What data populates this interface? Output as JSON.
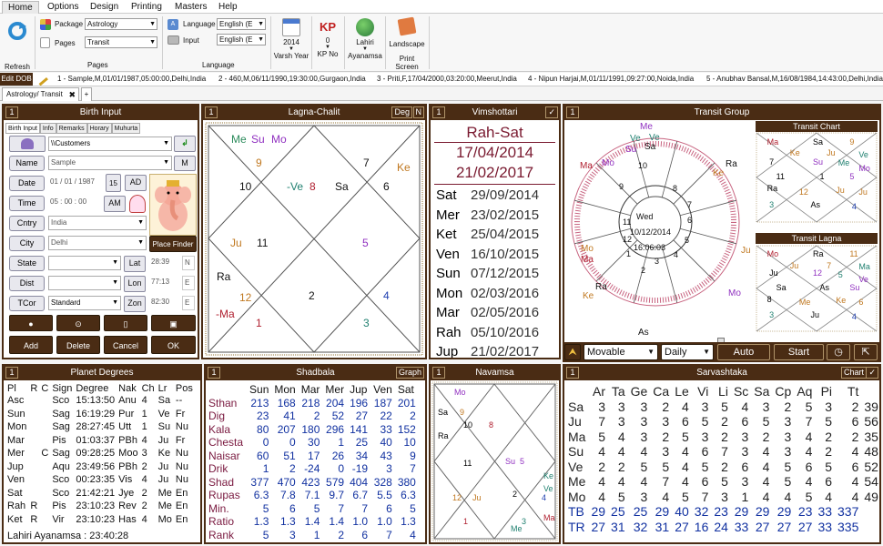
{
  "menu": [
    "Home",
    "Options",
    "Design",
    "Printing",
    "Masters",
    "Help"
  ],
  "ribbon": {
    "refresh": "Refresh",
    "package_label": "Package",
    "package_value": "Astrology",
    "pages_label": "Pages",
    "pages_value": "Transit",
    "pages_group": "Pages",
    "language_label": "Language",
    "language_value": "English (E",
    "input_label": "Input",
    "input_value": "English (E",
    "language_group": "Language",
    "varsh_value": "2014",
    "varsh_label": "Varsh Year",
    "kp_value": "0",
    "kp_label": "KP No",
    "kp_icon": "KP",
    "ayan_value": "Lahiri",
    "ayan_label": "Ayanamsa",
    "print_value": "Landscape",
    "print_label": "Print Screen"
  },
  "recents": {
    "edit": "Edit DOB",
    "items": [
      "1 - Sample,M,01/01/1987,05:00:00,Delhi,India",
      "2 - 460,M,06/11/1990,19:30:00,Gurgaon,India",
      "3 - Priti,F,17/04/2000,03:20:00,Meerut,India",
      "4 - Nipun Harjai,M,01/11/1991,09:27:00,Noida,India",
      "5 - Anubhav Bansal,M,16/08/1984,14:43:00,Delhi,India"
    ]
  },
  "doc_tab": "Astrology/ Transit",
  "birth_input": {
    "num": "1",
    "title": "Birth Input",
    "tabs": [
      "Birth Input",
      "Info",
      "Remarks",
      "Horary",
      "Muhurta"
    ],
    "folder": "\\\\Customers",
    "name_label": "Name",
    "name_value": "Sample",
    "gender": "M",
    "date_label": "Date",
    "date_value": "01 / 01 / 1987",
    "cal_num": "15",
    "era": "AD",
    "time_label": "Time",
    "time_value": "05 : 00 : 00",
    "ampm": "AM",
    "cntry_label": "Cntry",
    "cntry_value": "India",
    "city_label": "City",
    "city_value": "Delhi",
    "place_finder": "Place Finder",
    "state_label": "State",
    "lat_label": "Lat",
    "lat_value": "28:39",
    "lat_dir": "N",
    "dist_label": "Dist",
    "lon_label": "Lon",
    "lon_value": "77:13",
    "lon_dir": "E",
    "tcor_label": "TCor",
    "tcor_value": "Standard",
    "zon_label": "Zon",
    "zon_value": "82:30",
    "zon_dir": "E",
    "actions": [
      "Add",
      "Delete",
      "Cancel",
      "OK"
    ]
  },
  "lagna": {
    "num": "1",
    "title": "Lagna-Chalit",
    "btn1": "Deg",
    "btn2": "N",
    "labels": {
      "top_left_planets": [
        "Me",
        "Su",
        "Mo"
      ],
      "h9": "9",
      "h10": "10",
      "h8": "-Ve",
      "h8n": "8",
      "h8p": "Sa",
      "h7": "7",
      "h6": "6",
      "ke": "Ke",
      "ju": "Ju",
      "h11": "11",
      "h5": "5",
      "ra": "Ra",
      "h12": "12",
      "h2": "2",
      "h4": "4",
      "ma": "-Ma",
      "h1": "1",
      "h3": "3"
    }
  },
  "vimshottari": {
    "num": "1",
    "title": "Vimshottari",
    "check": "✓",
    "period": "Rah-Sat",
    "start": "17/04/2014",
    "end": "21/02/2017",
    "rows": [
      {
        "planet": "Sat",
        "date": "29/09/2014"
      },
      {
        "planet": "Mer",
        "date": "23/02/2015"
      },
      {
        "planet": "Ket",
        "date": "25/04/2015"
      },
      {
        "planet": "Ven",
        "date": "16/10/2015"
      },
      {
        "planet": "Sun",
        "date": "07/12/2015"
      },
      {
        "planet": "Mon",
        "date": "02/03/2016"
      },
      {
        "planet": "Mar",
        "date": "02/05/2016"
      },
      {
        "planet": "Rah",
        "date": "05/10/2016"
      },
      {
        "planet": "Jup",
        "date": "21/02/2017"
      }
    ]
  },
  "transit": {
    "num": "1",
    "title": "Transit Group",
    "day": "Wed",
    "date": "10/12/2014",
    "time": "16:06:03",
    "wheel_planets": [
      "Me",
      "Ve",
      "Su",
      "Sa",
      "Mo",
      "Ke",
      "Ra",
      "Ju",
      "Ma",
      "Ra",
      "Ke",
      "Mo",
      "Ju",
      "Ma",
      "As",
      "As"
    ],
    "houses": [
      "10",
      "9",
      "8",
      "7",
      "6",
      "5",
      "4",
      "3",
      "2",
      "1",
      "12",
      "11"
    ],
    "transit_chart_title": "Transit Chart",
    "transit_lagna_title": "Transit Lagna",
    "mode": "Movable",
    "freq": "Daily",
    "auto": "Auto",
    "start": "Start",
    "tc_labels": [
      "Ma",
      "Sa",
      "9",
      "Ke",
      "Ju",
      "Ve",
      "7",
      "Su",
      "Me",
      "Mo",
      "11",
      "1",
      "5",
      "Ra",
      "12",
      "Ju",
      "Ju",
      "3",
      "As",
      "4"
    ],
    "tl_labels": [
      "Mo",
      "Ra",
      "11",
      "Ju",
      "7",
      "Ma",
      "Ju",
      "12",
      "5",
      "Ve",
      "Sa",
      "As",
      "Su",
      "8",
      "Me",
      "Ke",
      "6",
      "3",
      "Ju",
      "4"
    ]
  },
  "planet_degrees": {
    "num": "1",
    "title": "Planet Degrees",
    "headers": [
      "Pl",
      "R",
      "C",
      "Sign",
      "Degree",
      "Nak",
      "Ch",
      "Lr",
      "Pos"
    ],
    "rows": [
      [
        "Asc",
        "",
        "",
        "Sco",
        "15:13:50",
        "Anu",
        "4",
        "Sa",
        "--"
      ],
      [
        "Sun",
        "",
        "",
        "Sag",
        "16:19:29",
        "Pur",
        "1",
        "Ve",
        "Fr"
      ],
      [
        "Mon",
        "",
        "",
        "Sag",
        "28:27:45",
        "Utt",
        "1",
        "Su",
        "Nu"
      ],
      [
        "Mar",
        "",
        "",
        "Pis",
        "01:03:37",
        "PBh",
        "4",
        "Ju",
        "Fr"
      ],
      [
        "Mer",
        "",
        "C",
        "Sag",
        "09:28:25",
        "Moo",
        "3",
        "Ke",
        "Nu"
      ],
      [
        "Jup",
        "",
        "",
        "Aqu",
        "23:49:56",
        "PBh",
        "2",
        "Ju",
        "Nu"
      ],
      [
        "Ven",
        "",
        "",
        "Sco",
        "00:23:35",
        "Vis",
        "4",
        "Ju",
        "Nu"
      ],
      [
        "Sat",
        "",
        "",
        "Sco",
        "21:42:21",
        "Jye",
        "2",
        "Me",
        "En"
      ],
      [
        "Rah",
        "R",
        "",
        "Pis",
        "23:10:23",
        "Rev",
        "2",
        "Me",
        "En"
      ],
      [
        "Ket",
        "R",
        "",
        "Vir",
        "23:10:23",
        "Has",
        "4",
        "Mo",
        "En"
      ]
    ],
    "footer": "Lahiri Ayanamsa : 23:40:28"
  },
  "shadbala": {
    "num": "1",
    "title": "Shadbala",
    "btn": "Graph",
    "headers": [
      "",
      "Sun",
      "Mon",
      "Mar",
      "Mer",
      "Jup",
      "Ven",
      "Sat"
    ],
    "rows": [
      [
        "Sthan",
        "213",
        "168",
        "218",
        "204",
        "196",
        "187",
        "201"
      ],
      [
        "Dig",
        "23",
        "41",
        "2",
        "52",
        "27",
        "22",
        "2"
      ],
      [
        "Kala",
        "80",
        "207",
        "180",
        "296",
        "141",
        "33",
        "152"
      ],
      [
        "Chesta",
        "0",
        "0",
        "30",
        "1",
        "25",
        "40",
        "10"
      ],
      [
        "Naisar",
        "60",
        "51",
        "17",
        "26",
        "34",
        "43",
        "9"
      ],
      [
        "Drik",
        "1",
        "2",
        "-24",
        "0",
        "-19",
        "3",
        "7"
      ],
      [
        "Shad",
        "377",
        "470",
        "423",
        "579",
        "404",
        "328",
        "380"
      ],
      [
        "Rupas",
        "6.3",
        "7.8",
        "7.1",
        "9.7",
        "6.7",
        "5.5",
        "6.3"
      ],
      [
        "Min.",
        "5",
        "6",
        "5",
        "7",
        "7",
        "6",
        "5"
      ],
      [
        "Ratio",
        "1.3",
        "1.3",
        "1.4",
        "1.4",
        "1.0",
        "1.0",
        "1.3"
      ],
      [
        "Rank",
        "5",
        "3",
        "1",
        "2",
        "6",
        "7",
        "4"
      ]
    ]
  },
  "navamsa": {
    "num": "1",
    "title": "Navamsa",
    "labels": [
      "Mo",
      "Sa",
      "9",
      "Ra",
      "10",
      "8",
      "11",
      "Su",
      "5",
      "Ke",
      "Ve",
      "12",
      "Ju",
      "2",
      "4",
      "Ma",
      "1",
      "3",
      "Me"
    ]
  },
  "sarvashtaka": {
    "num": "1",
    "title": "Sarvashtaka",
    "btn": "Chart",
    "check": "✓",
    "headers": [
      "",
      "Ar",
      "Ta",
      "Ge",
      "Ca",
      "Le",
      "Vi",
      "Li",
      "Sc",
      "Sa",
      "Cp",
      "Aq",
      "Pi",
      "Tt"
    ],
    "rows": [
      [
        "Sa",
        "3",
        "3",
        "3",
        "2",
        "4",
        "3",
        "5",
        "4",
        "3",
        "2",
        "5",
        "3",
        "2",
        "39"
      ],
      [
        "Ju",
        "7",
        "3",
        "3",
        "3",
        "6",
        "5",
        "2",
        "6",
        "5",
        "3",
        "7",
        "5",
        "6",
        "56"
      ],
      [
        "Ma",
        "5",
        "4",
        "3",
        "2",
        "5",
        "3",
        "2",
        "3",
        "2",
        "3",
        "4",
        "2",
        "2",
        "35"
      ],
      [
        "Su",
        "4",
        "4",
        "4",
        "3",
        "4",
        "6",
        "7",
        "3",
        "4",
        "3",
        "4",
        "2",
        "4",
        "48"
      ],
      [
        "Ve",
        "2",
        "2",
        "5",
        "5",
        "4",
        "5",
        "2",
        "6",
        "4",
        "5",
        "6",
        "5",
        "6",
        "52"
      ],
      [
        "Me",
        "4",
        "4",
        "4",
        "7",
        "4",
        "6",
        "5",
        "3",
        "4",
        "5",
        "4",
        "6",
        "4",
        "54"
      ],
      [
        "Mo",
        "4",
        "5",
        "3",
        "4",
        "5",
        "7",
        "3",
        "1",
        "4",
        "4",
        "5",
        "4",
        "4",
        "49"
      ],
      [
        "TB",
        "29",
        "25",
        "25",
        "29",
        "40",
        "32",
        "23",
        "29",
        "29",
        "29",
        "23",
        "33",
        "337"
      ],
      [
        "TR",
        "27",
        "31",
        "32",
        "31",
        "27",
        "16",
        "24",
        "33",
        "27",
        "27",
        "27",
        "33",
        "335"
      ]
    ]
  },
  "colors": {
    "panel_border": "#4a2c14",
    "planet_red": "#b02030",
    "planet_purple": "#9030c0",
    "planet_orange": "#c07820",
    "planet_teal": "#208070",
    "planet_blue": "#2040b0",
    "table_blue": "#1030a0"
  }
}
